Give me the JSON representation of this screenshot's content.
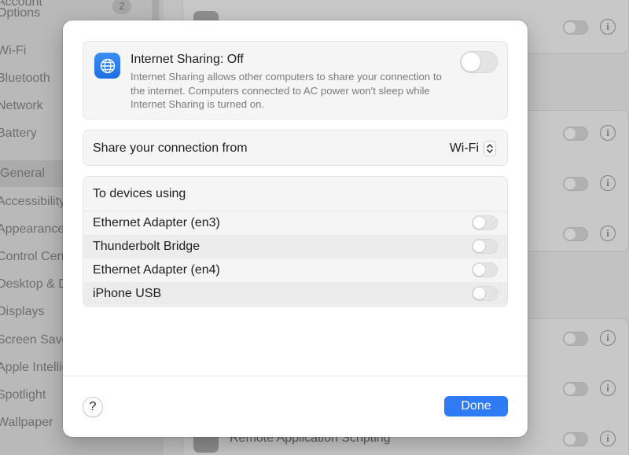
{
  "background": {
    "sidebar_items": [
      {
        "label": "Account"
      },
      {
        "label": "Options"
      },
      {
        "label": "Wi-Fi"
      },
      {
        "label": "Bluetooth"
      },
      {
        "label": "Network"
      },
      {
        "label": "Battery"
      },
      {
        "label": "General"
      },
      {
        "label": "Accessibility"
      },
      {
        "label": "Appearance"
      },
      {
        "label": "Control Centre"
      },
      {
        "label": "Desktop & Dock"
      },
      {
        "label": "Displays"
      },
      {
        "label": "Screen Saver"
      },
      {
        "label": "Apple Intelligence"
      },
      {
        "label": "Spotlight"
      },
      {
        "label": "Wallpaper"
      }
    ],
    "badge": "2",
    "remote_row_label": "Remote Application Scripting",
    "info_glyph": "i"
  },
  "sheet": {
    "sharing": {
      "title": "Internet Sharing: Off",
      "description": "Internet Sharing allows other computers to share your connection to the internet. Computers connected to AC power won't sleep while Internet Sharing is turned on.",
      "icon": "globe-icon",
      "enabled": false
    },
    "share_from": {
      "label": "Share your connection from",
      "value": "Wi-Fi"
    },
    "devices": {
      "header": "To devices using",
      "items": [
        {
          "label": "Ethernet Adapter (en3)",
          "enabled": false
        },
        {
          "label": "Thunderbolt Bridge",
          "enabled": false
        },
        {
          "label": "Ethernet Adapter (en4)",
          "enabled": false
        },
        {
          "label": "iPhone USB",
          "enabled": false
        }
      ]
    },
    "help_label": "?",
    "done_label": "Done"
  },
  "colors": {
    "accent": "#2f7bf5",
    "icon_blue": "#1f6fe4"
  }
}
